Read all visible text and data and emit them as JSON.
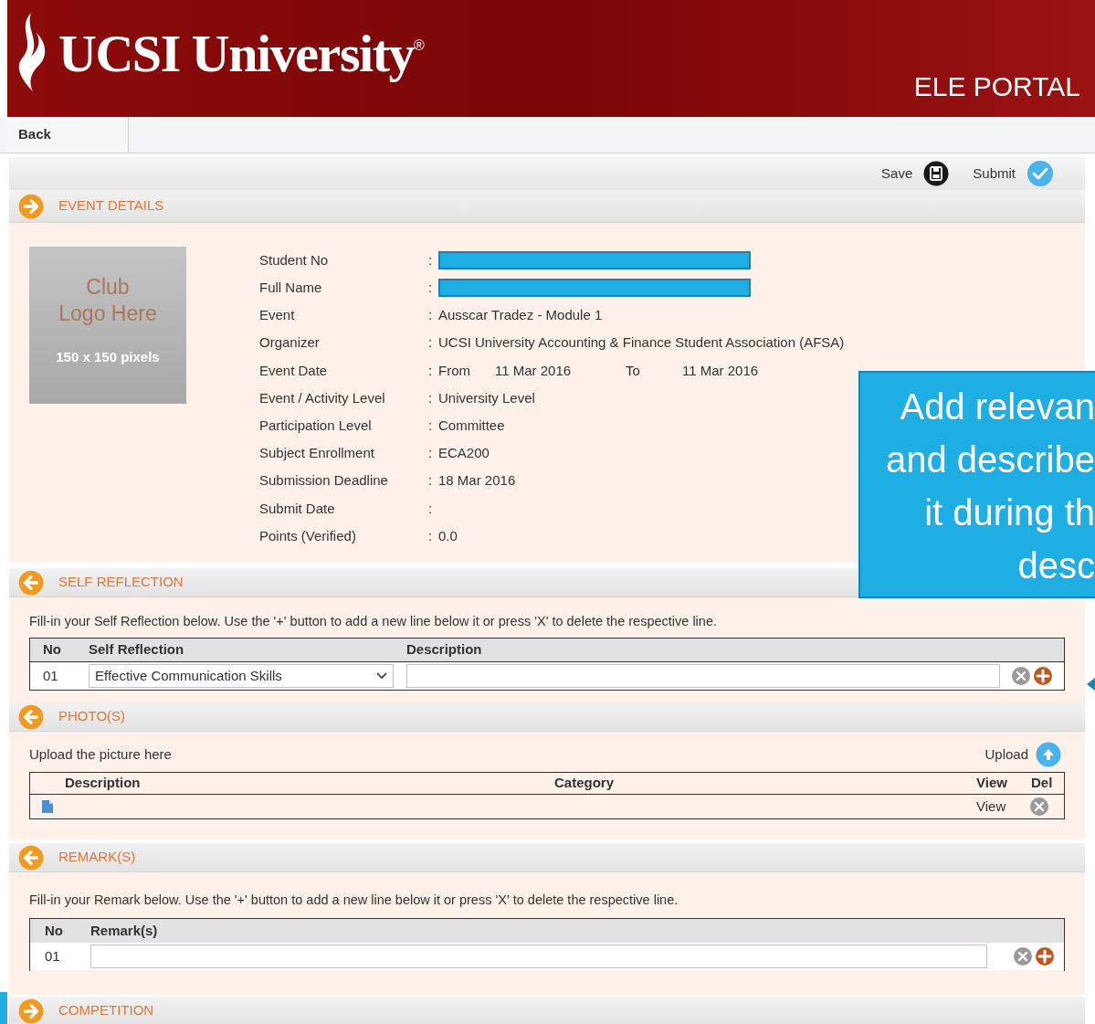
{
  "header": {
    "logo_text": "UCSI University",
    "registered": "®",
    "portal": "ELE PORTAL"
  },
  "nav": {
    "back": "Back"
  },
  "toolbar": [
    {
      "label": "Save",
      "kind": "save"
    },
    {
      "label": "Submit",
      "kind": "submit"
    }
  ],
  "event_details": {
    "title": "EVENT DETAILS",
    "kind": "right",
    "logo": {
      "line1": "Club",
      "line2": "Logo Here",
      "size": "150 x 150 pixels"
    },
    "fields": [
      {
        "label": "Student No",
        "separator": ":",
        "kind": "redacted"
      },
      {
        "label": "Full Name",
        "separator": ":",
        "kind": "redacted"
      },
      {
        "label": "Event",
        "separator": ":",
        "kind": "text",
        "value": "Ausscar Tradez - Module 1"
      },
      {
        "label": "Organizer",
        "separator": ":",
        "kind": "text",
        "value": "UCSI University Accounting & Finance Student Association (AFSA)"
      },
      {
        "label": "Event Date",
        "separator": ":",
        "kind": "range",
        "parts": [
          "From",
          "11 Mar 2016",
          "To",
          "11 Mar 2016"
        ]
      },
      {
        "label": "Event / Activity Level",
        "separator": ":",
        "kind": "text",
        "value": "University Level"
      },
      {
        "label": "Participation Level",
        "separator": ":",
        "kind": "text",
        "value": "Committee"
      },
      {
        "label": "Subject Enrollment",
        "separator": ":",
        "kind": "text",
        "value": "ECA200"
      },
      {
        "label": "Submission Deadline",
        "separator": ":",
        "kind": "text",
        "value": "18 Mar 2016"
      },
      {
        "label": "Submit Date",
        "separator": ":",
        "kind": "empty"
      },
      {
        "label": "Points (Verified)",
        "separator": ":",
        "kind": "text",
        "value": "0.0"
      }
    ]
  },
  "self_reflection": {
    "title": "SELF REFLECTION",
    "kind": "left",
    "instructions": "Fill-in your Self Reflection below. Use the '+' button to add a new line below it or press 'X' to delete the respective line.",
    "columns": [
      "No",
      "Self Reflection",
      "Description"
    ],
    "rows": [
      {
        "no": "01",
        "selection": "Effective Communication Skills"
      }
    ]
  },
  "photos": {
    "title": "PHOTO(S)",
    "kind": "left",
    "instructions": "Upload the picture here",
    "upload": "Upload",
    "columns": [
      "Description",
      "Category",
      "View",
      "Del"
    ],
    "rows": [
      {
        "view": "View"
      }
    ]
  },
  "remarks": {
    "title": "REMARK(S)",
    "kind": "left",
    "instructions": "Fill-in your Remark below. Use the '+' button to add a new line below it or press 'X' to delete the respective line.",
    "columns": [
      "No",
      "Remark(s)"
    ],
    "rows": [
      {
        "no": "01"
      }
    ]
  },
  "competition": {
    "title": "COMPETITION",
    "kind": "right"
  },
  "callout": {
    "lines": [
      "Add relevan",
      "and describe",
      "it during th",
      "desc"
    ]
  }
}
